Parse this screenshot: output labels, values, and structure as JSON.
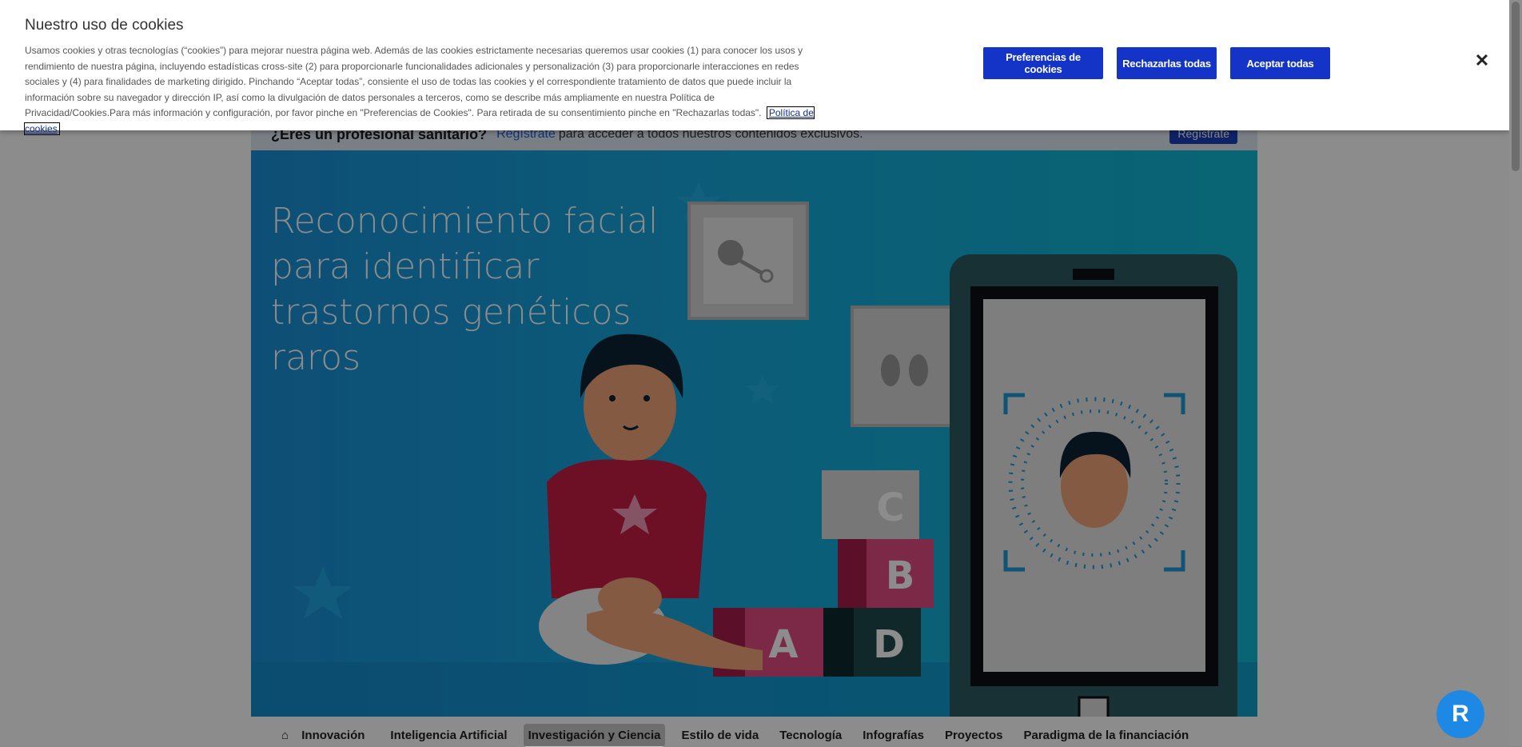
{
  "registration": {
    "question": "¿Eres un profesional sanitario?",
    "link": "Regístrate",
    "text": "para acceder a todos nuestros contenidos exclusivos.",
    "button": "Regístrate"
  },
  "hero": {
    "title": "Reconocimiento facial para identificar trastornos genéticos raros",
    "block_letters": [
      "C",
      "B",
      "A",
      "D"
    ]
  },
  "tabs": [
    "Innovación",
    "Inteligencia Artificial",
    "Investigación y Ciencia",
    "Estilo de vida",
    "Tecnología",
    "Infografías",
    "Proyectos",
    "Paradigma de la financiación"
  ],
  "active_tab": "Investigación y Ciencia",
  "cookie_banner": {
    "title": "Nuestro uso de cookies",
    "body": "Usamos cookies y otras tecnologías (“cookies”) para mejorar nuestra página web. Además de las cookies estrictamente necesarias queremos usar cookies (1) para conocer los usos y rendimiento de nuestra página, incluyendo estadísticas cross-site (2) para proporcionarle funcionalidades adicionales y personalización (3) para proporcionarle interacciones en redes sociales y (4) para finalidades de marketing dirigido. Pinchando “Aceptar todas”, consiente el uso de todas las cookies y el correspondiente tratamiento de datos que puede incluir la información sobre su navegador y dirección IP, así como la divulgación de datos personales a terceros, como se describe más ampliamente en nuestra Política de Privacidad/Cookies.Para más información y configuración, por favor pinche en \"Preferencias de Cookies\". Para retirada de su consentimiento pinche en \"Rechazarlas todas\".",
    "policy_link": "Política de cookies",
    "preferences_button": "Preferencias de cookies",
    "reject_button": "Rechazarlas todas",
    "accept_button": "Aceptar todas",
    "close_icon": "close-icon"
  },
  "colors": {
    "primary_button": "#1434c8",
    "hero_bg": "#16a8dc"
  }
}
